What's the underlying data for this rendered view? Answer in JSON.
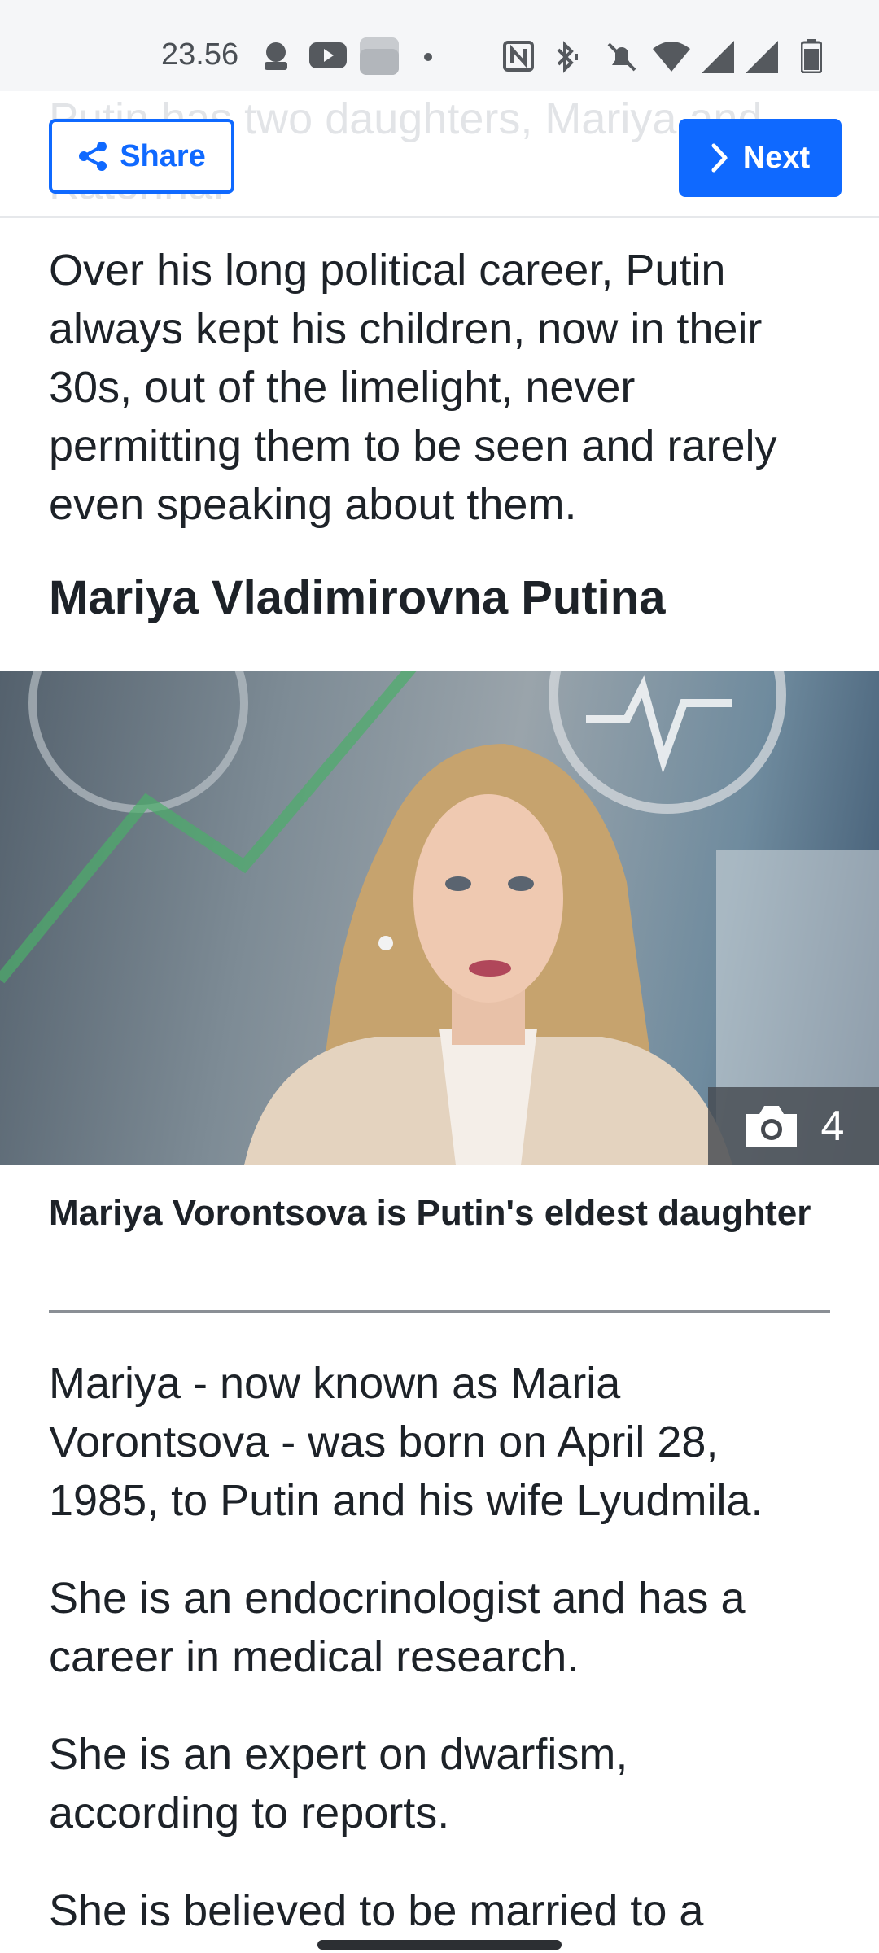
{
  "status_bar": {
    "time": "23.56",
    "icons": [
      "signal-app-icon",
      "youtube-icon",
      "files-icon",
      "dot-icon",
      "nfc-icon",
      "bluetooth-icon",
      "mute-icon",
      "wifi-icon",
      "cell-signal-icon",
      "cell-signal-icon",
      "battery-icon"
    ]
  },
  "toolbar": {
    "behind_text": "Putin has two daughters, Mariya and Katerina.",
    "share_label": "Share",
    "next_label": "Next"
  },
  "article": {
    "intro": "Over his long political career, Putin always kept his children, now in their 30s, out of the limelight, never permitting them to be seen and rarely even speaking about them.",
    "section_title": "Mariya Vladimirovna Putina",
    "photo_count": "4",
    "caption": "Mariya Vorontsova is Putin's eldest daughter",
    "paragraphs": [
      "Mariya - now known as Maria Vorontsova - was born on April 28, 1985, to Putin and his wife Lyudmila.",
      "She is an endocrinologist and has a career in medical research.",
      "She is an expert on dwarfism, according to reports.",
      "She is believed to be married to a"
    ]
  },
  "colors": {
    "accent": "#0f69ff",
    "text": "#1d2228"
  }
}
